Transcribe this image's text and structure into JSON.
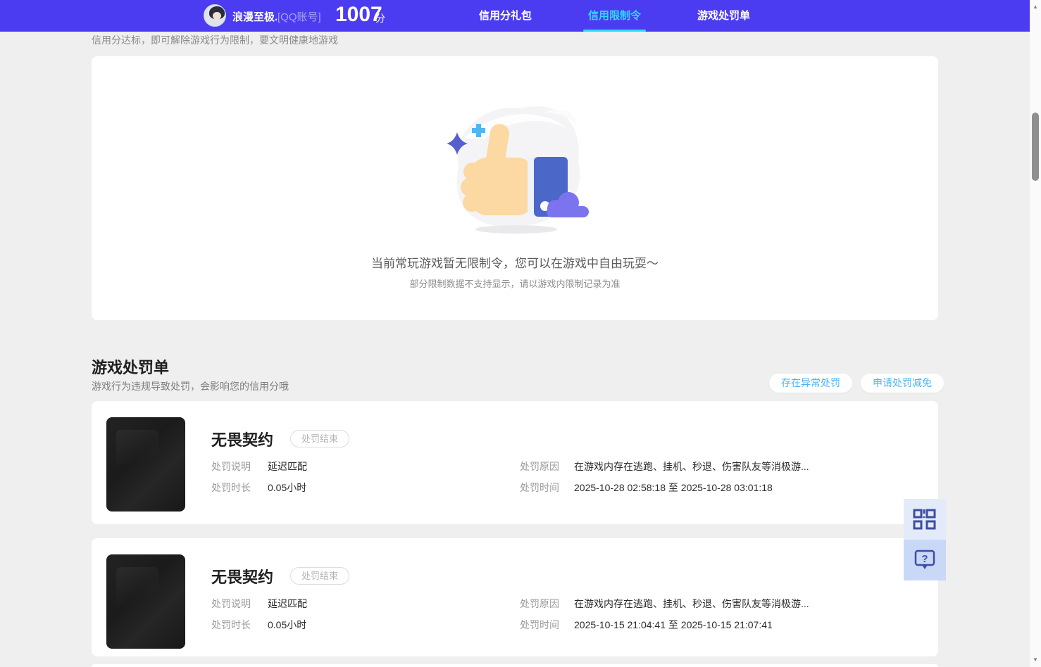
{
  "header": {
    "username": "浪漫至极.",
    "account_type": "[QQ账号]",
    "score": "1007",
    "score_unit": "分",
    "tabs": [
      {
        "label": "信用分礼包",
        "active": false
      },
      {
        "label": "信用限制令",
        "active": true
      },
      {
        "label": "游戏处罚单",
        "active": false
      }
    ]
  },
  "intro_line": "信用分达标，即可解除游戏行为限制，要文明健康地游戏",
  "empty_state": {
    "message": "当前常玩游戏暂无限制令，您可以在游戏中自由玩耍～",
    "note": "部分限制数据不支持显示，请以游戏内限制记录为准"
  },
  "penalty_section": {
    "title": "游戏处罚单",
    "subtitle": "游戏行为违规导致处罚，会影响您的信用分哦",
    "buttons": {
      "abnormal": "存在异常处罚",
      "reduction": "申请处罚减免"
    },
    "labels": {
      "desc": "处罚说明",
      "duration": "处罚时长",
      "reason": "处罚原因",
      "time": "处罚时间"
    },
    "cards": [
      {
        "game": "无畏契约",
        "status": "处罚结束",
        "desc": "延迟匹配",
        "duration": "0.05小时",
        "reason": "在游戏内存在逃跑、挂机、秒退、伤害队友等消极游...",
        "time": "2025-10-28 02:58:18 至 2025-10-28 03:01:18"
      },
      {
        "game": "无畏契约",
        "status": "处罚结束",
        "desc": "延迟匹配",
        "duration": "0.05小时",
        "reason": "在游戏内存在逃跑、挂机、秒退、伤害队友等消极游...",
        "time": "2025-10-15 21:04:41 至 2025-10-15 21:07:41"
      }
    ]
  },
  "scrollbar": {
    "up": "▲",
    "down": "▼"
  },
  "colors": {
    "header_bg": "#4b3cf2",
    "active_tab": "#2fd9f8",
    "accent_blue": "#4cb4f2",
    "page_bg": "#efefef"
  }
}
